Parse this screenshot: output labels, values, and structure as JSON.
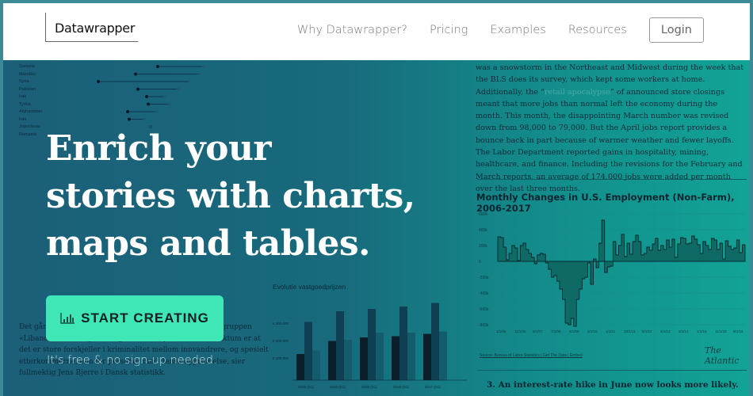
{
  "header": {
    "logo": "Datawrapper",
    "nav": [
      "Why Datawrapper?",
      "Pricing",
      "Examples",
      "Resources"
    ],
    "login": "Login"
  },
  "hero": {
    "headline_lines": [
      "Enrich your",
      "stories with charts,",
      "maps and tables."
    ],
    "cta": {
      "label": "START CREATING",
      "icon": "bar-chart-icon"
    },
    "subtext": "It's free & no sign-up needed.",
    "cta_color": "#3fe7b7"
  },
  "background": {
    "dumbbell_labels": [
      "Somalia",
      "Marokko",
      "Syria",
      "Pakistan",
      "Irak",
      "Tyrkia",
      "Afghanistan",
      "Iran",
      "Jugoslavia",
      "Romania"
    ],
    "article_text_before": "was a snowstorm in the Northeast and Midwest during the week that the BLS does its survey, which kept some workers at home. Additionally, the “",
    "article_link": "retail apocalypse",
    "article_text_after": "” of announced store closings meant that more jobs than normal left the economy during the month. This month, the disappointing March number was revised down from 98,000 to 79,000. But the April jobs report provides a bounce back in part because of warmer weather and fewer layoffs. The Labor Department reported gains in hospitality, mining, healthcare, and finance. Including the revisions for the February and March reports, an average of 174,000 jobs were added per month over the last three months.",
    "employment_chart": {
      "title": "Monthly Changes in U.S. Employment (Non-Farm), 2006-2017",
      "y_ticks": [
        "600k",
        "400k",
        "200k",
        "0",
        "-200k",
        "-400k",
        "-600k",
        "-800k"
      ],
      "x_ticks": [
        "1/1/06",
        "11/1/06",
        "9/1/07",
        "7/1/08",
        "5/1/09",
        "3/1/10",
        "1/1/11",
        "10/1/11",
        "8/1/12",
        "6/1/13",
        "3/1/14",
        "1/1/15",
        "11/1/15",
        "9/1/16"
      ],
      "values": [
        310,
        300,
        180,
        20,
        100,
        200,
        170,
        10,
        200,
        230,
        150,
        100,
        50,
        -30,
        80,
        100,
        90,
        -20,
        -100,
        -200,
        -180,
        -250,
        -350,
        -480,
        -780,
        -800,
        -720,
        -820,
        -480,
        -350,
        -220,
        -200,
        -20,
        -290,
        30,
        -80,
        230,
        520,
        -140,
        -70,
        -60,
        250,
        80,
        200,
        340,
        60,
        230,
        90,
        250,
        330,
        250,
        80,
        100,
        180,
        140,
        220,
        290,
        140,
        200,
        150,
        270,
        180,
        280,
        50,
        220,
        300,
        290,
        220,
        230,
        320,
        280,
        210,
        100,
        250,
        200,
        150,
        290,
        270,
        150,
        230,
        30,
        260,
        190,
        150,
        170,
        270,
        110,
        210
      ],
      "source": "Source: Bureau of Labor Statistics | Get The Data | Embed",
      "brand": "The Atlantic"
    },
    "next_heading": "3. An interest-rate hike in June now looks more likely.",
    "danish_text": "Det går frem af de seneste rapporter for innvandrere. I gruppen «Libanon» finnes også mange statsløse palestinere. – Faktum er at det er store forskjeller i kriminalitet mellom innvandrere, og spesielt etterkommerne, enn for personer med dansk opprinnelse, sier fullmektig Jens Bjerre i Dansk statistikk.",
    "bar_chart": {
      "title": "Evolutie vastgoedprijzen",
      "categories": [
        "2005 (S1)",
        "2010 (S1)",
        "2015 (S1)",
        "2016 (S1)",
        "2017 (S1)"
      ],
      "series": [
        [
          110,
          165,
          180,
          185,
          195
        ],
        [
          245,
          290,
          300,
          310,
          325
        ],
        [
          125,
          170,
          200,
          200,
          205
        ]
      ],
      "y_ticks": [
        "€ 300.000",
        "€ 200.000",
        "€ 100.000"
      ]
    }
  }
}
